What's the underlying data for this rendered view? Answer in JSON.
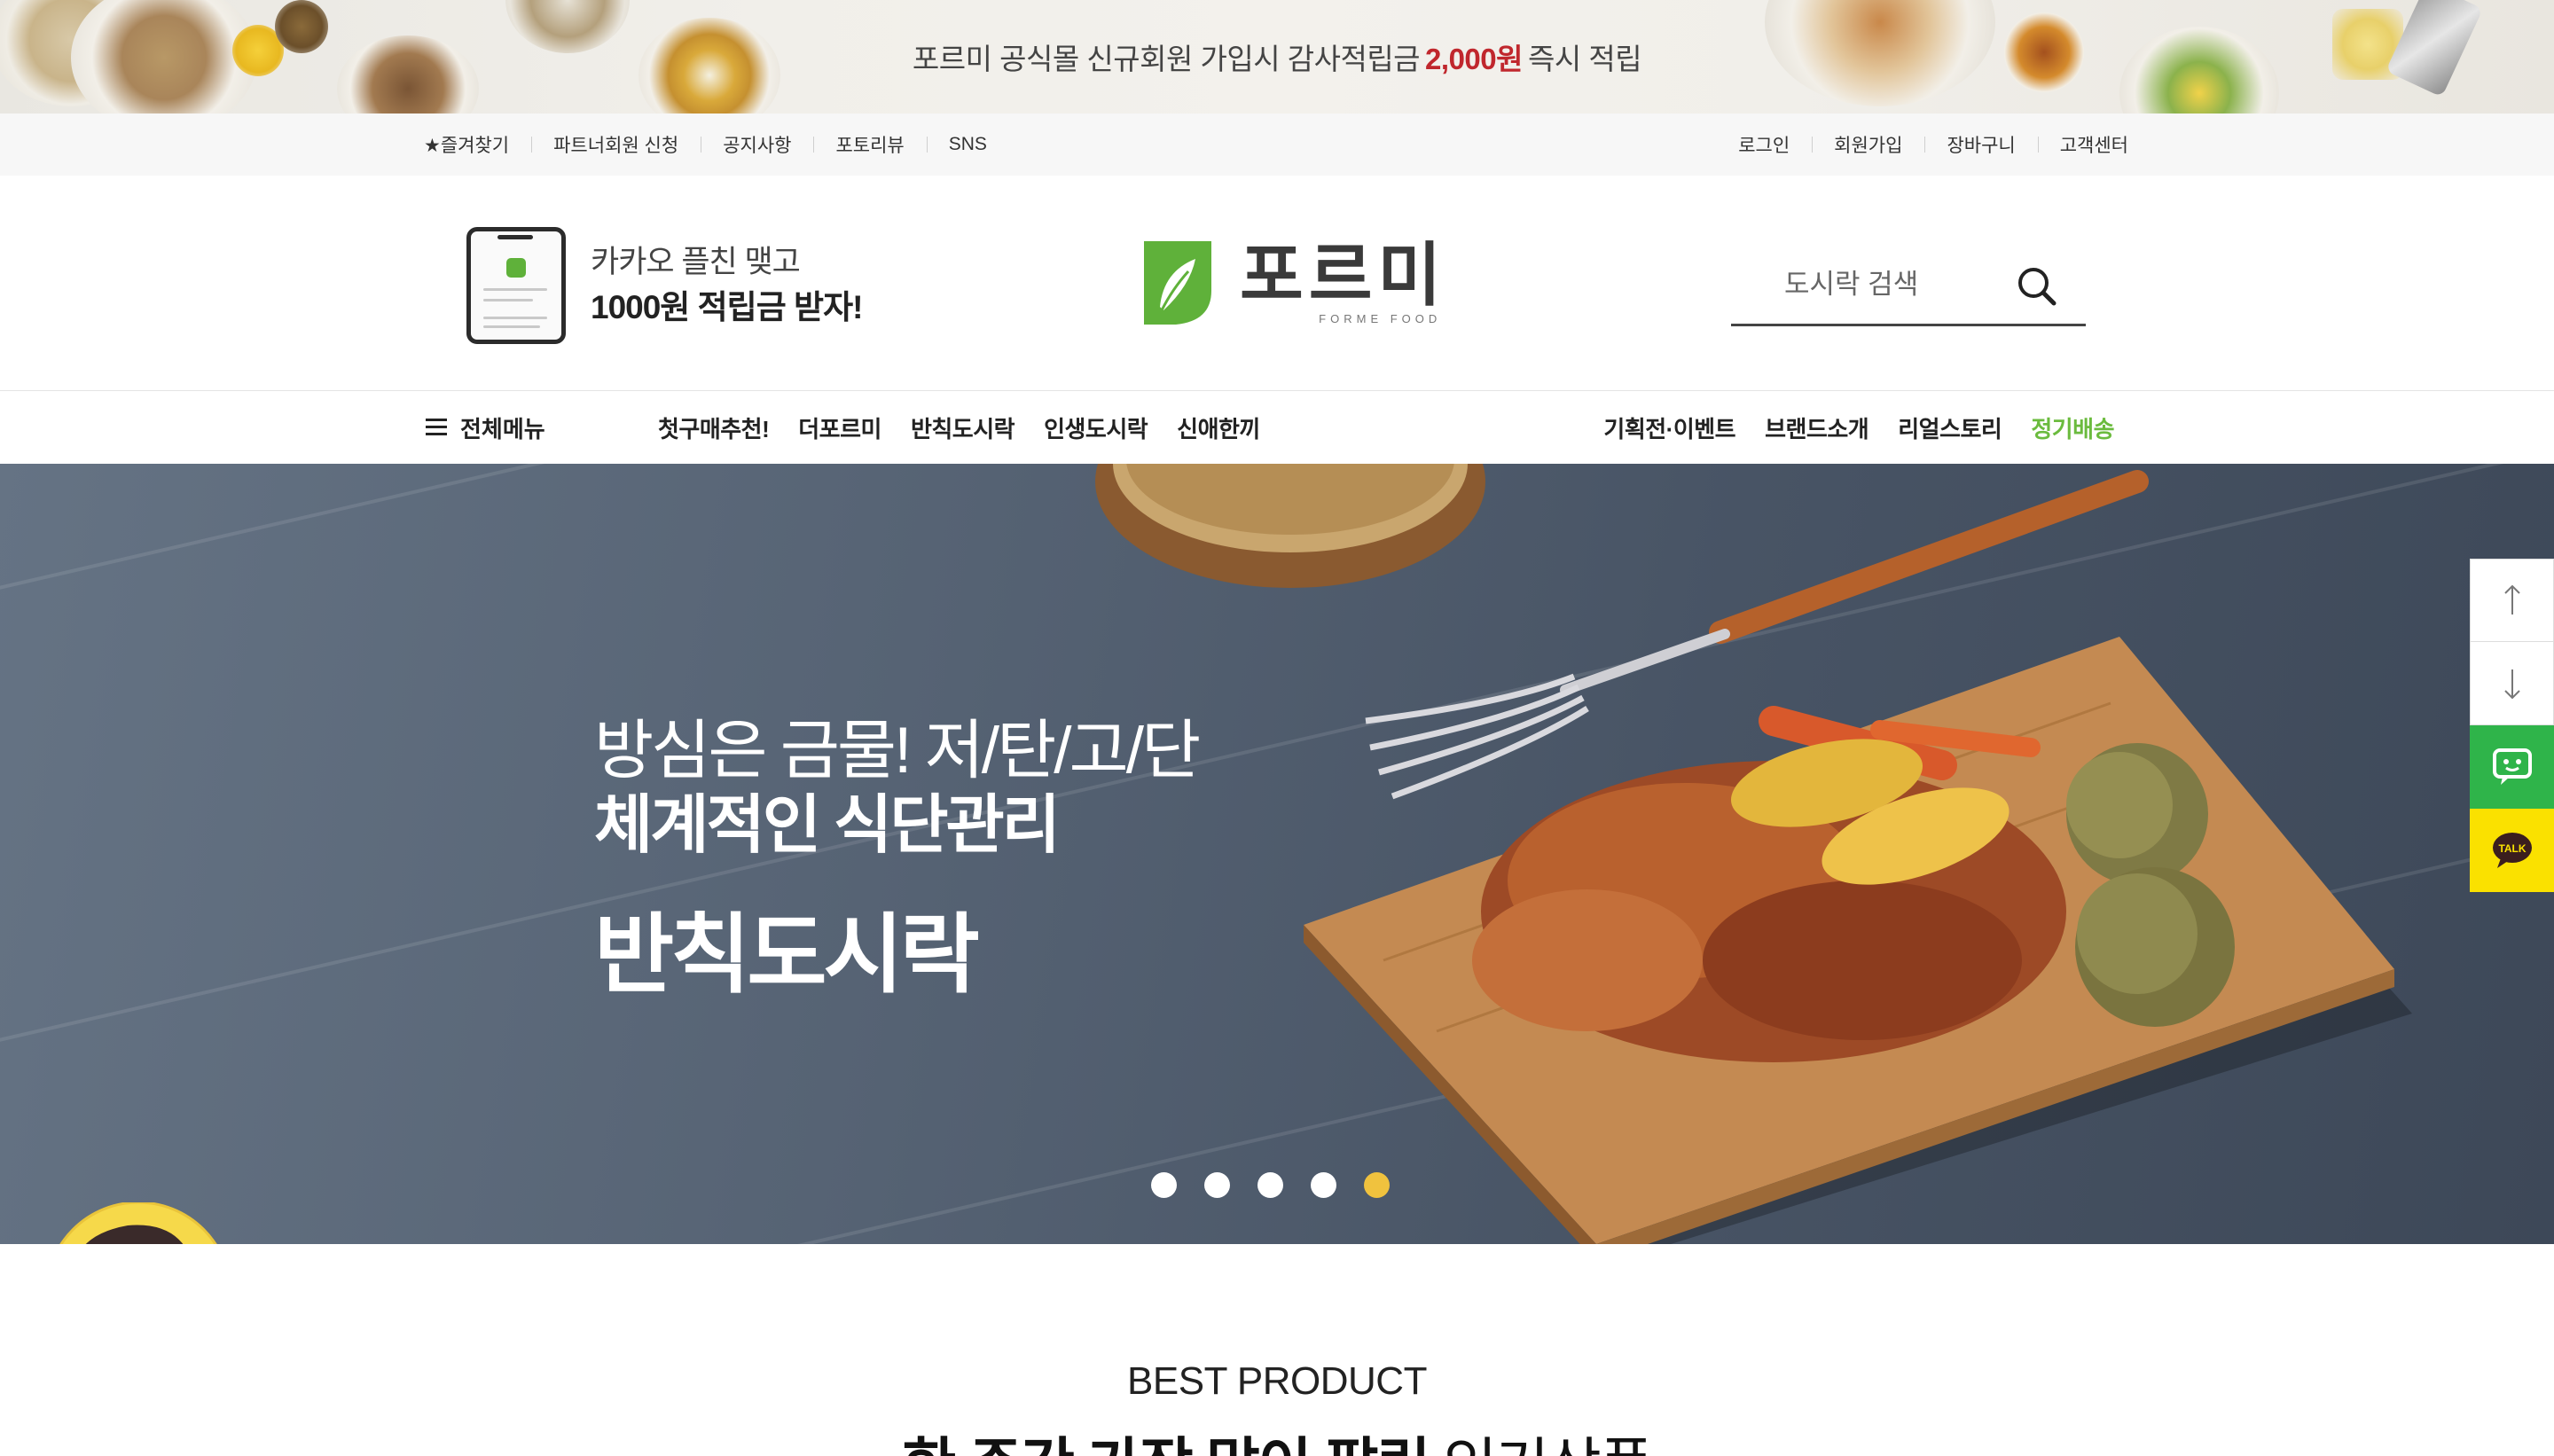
{
  "promo": {
    "text_before": "포르미 공식몰 신규회원 가입시 감사적립금",
    "highlight": "2,000원",
    "text_after": "즉시 적립",
    "highlight_color": "#c0272d"
  },
  "utility": {
    "left": [
      "★즐겨찾기",
      "파트너회원 신청",
      "공지사항",
      "포토리뷰",
      "SNS"
    ],
    "right": [
      "로그인",
      "회원가입",
      "장바구니",
      "고객센터"
    ]
  },
  "header": {
    "kakao_line1": "카카오 플친 맺고",
    "kakao_line2": "1000원 적립금 받자!",
    "brand_name": "포르미",
    "brand_sub": "FORME FOOD",
    "brand_color": "#5fb13a",
    "search_placeholder": "도시락 검색"
  },
  "gnb": {
    "all_menu": "전체메뉴",
    "main": [
      "첫구매추천!",
      "더포르미",
      "반칙도시락",
      "인생도시락",
      "신애한끼"
    ],
    "right": [
      "기획전·이벤트",
      "브랜드소개",
      "리얼스토리",
      "정기배송"
    ],
    "accent_color": "#6bbb3e"
  },
  "hero": {
    "line1": "방심은 금물! 저/탄/고/단",
    "line2": "체계적인 식단관리",
    "line3": "반칙도시락",
    "slide_count": 5,
    "active_slide": 5,
    "active_dot_color": "#f0c23e"
  },
  "quick": {
    "buttons": [
      "arrow-up-icon",
      "arrow-down-icon",
      "chat-icon",
      "kakao-talk-icon"
    ],
    "talk_label": "TALK"
  },
  "best": {
    "eyebrow": "BEST PRODUCT",
    "headline_bold": "한 주간 가장 많이 팔린",
    "headline_rest": "인기상품"
  }
}
